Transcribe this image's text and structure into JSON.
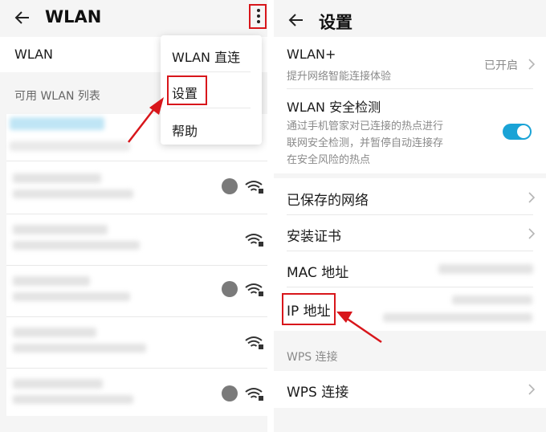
{
  "left": {
    "header": {
      "title": "WLAN"
    },
    "wlan_row": {
      "label": "WLAN"
    },
    "section": {
      "label": "可用 WLAN 列表"
    },
    "menu": {
      "items": [
        "WLAN 直连",
        "设置",
        "帮助"
      ]
    }
  },
  "right": {
    "header": {
      "title": "设置"
    },
    "wlan_plus": {
      "label": "WLAN+",
      "sub": "提升网络智能连接体验",
      "value": "已开启"
    },
    "security": {
      "label": "WLAN 安全检测",
      "sub1": "通过手机管家对已连接的热点进行",
      "sub2": "联网安全检测，并暂停自动连接存",
      "sub3": "在安全风险的热点",
      "enabled": true
    },
    "saved_networks": {
      "label": "已保存的网络"
    },
    "install_cert": {
      "label": "安装证书"
    },
    "mac": {
      "label": "MAC 地址"
    },
    "ip": {
      "label": "IP 地址"
    },
    "wps_section": {
      "label": "WPS 连接"
    },
    "wps": {
      "label": "WPS 连接"
    }
  },
  "colors": {
    "accent": "#1aa3d6",
    "highlight": "#d8161b",
    "text": "#1b1b1b",
    "subtext": "#8a8a8a"
  },
  "icons": [
    "back-arrow-icon",
    "more-vert-icon",
    "wifi-lock-icon",
    "hotspot-lock-icon",
    "chevron-right-icon"
  ]
}
